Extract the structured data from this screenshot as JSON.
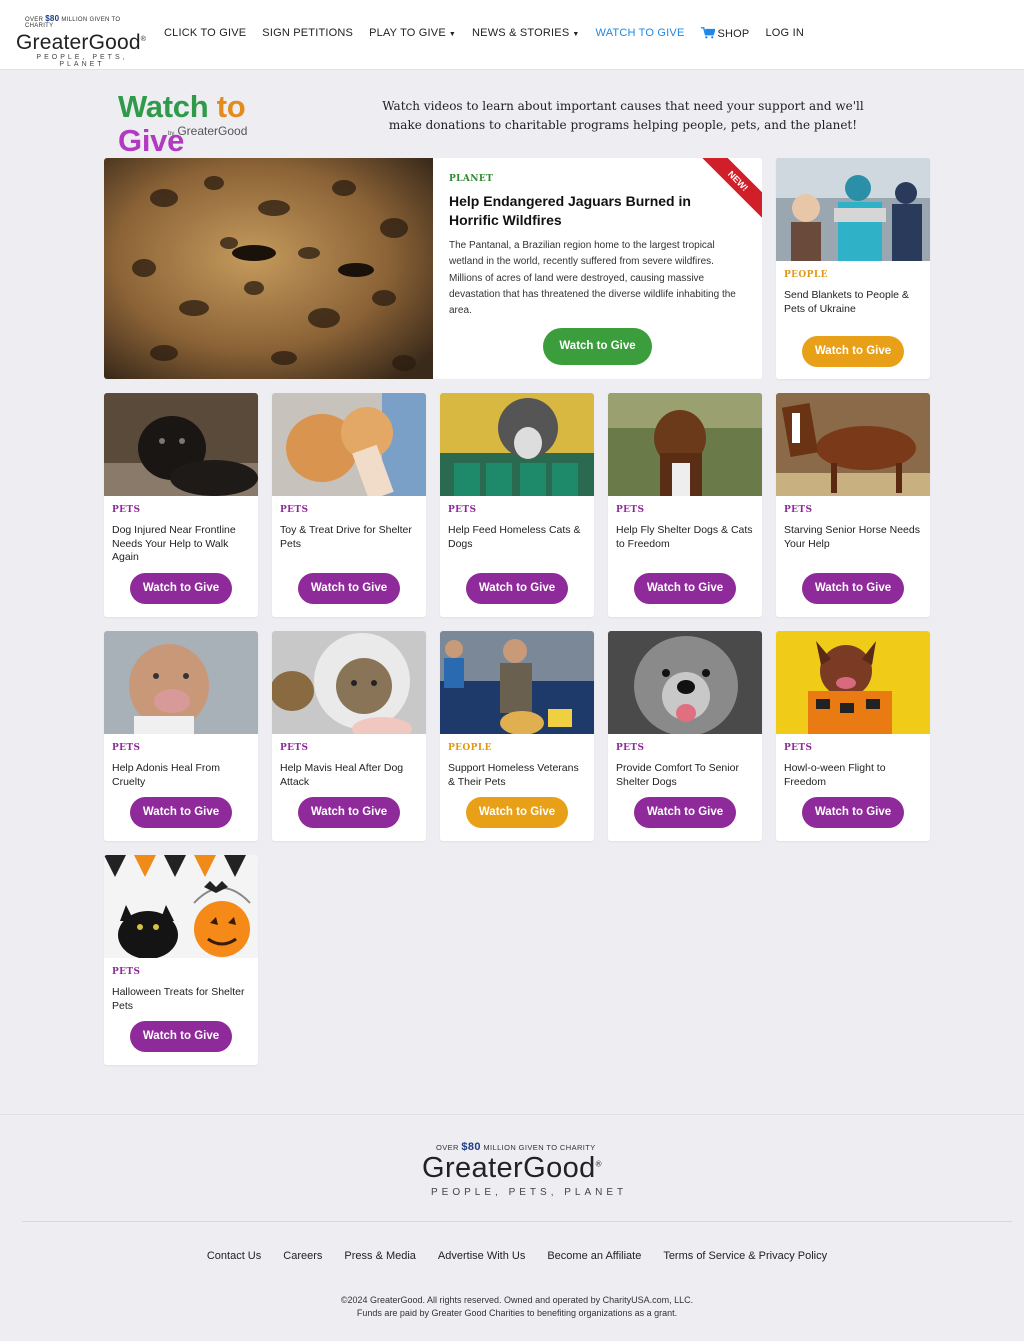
{
  "header": {
    "logo_over": "OVER",
    "logo_amount": "$80",
    "logo_over_suffix": "MILLION GIVEN TO CHARITY",
    "logo_name": "GreaterGood",
    "logo_registered": "®",
    "logo_tagline": "PEOPLE, PETS, PLANET",
    "nav": [
      {
        "label": "CLICK TO GIVE"
      },
      {
        "label": "SIGN PETITIONS"
      },
      {
        "label": "PLAY TO GIVE",
        "dropdown": true
      },
      {
        "label": "NEWS & STORIES",
        "dropdown": true
      },
      {
        "label": "WATCH TO GIVE",
        "active": true
      },
      {
        "label": "SHOP",
        "icon": "cart-icon"
      },
      {
        "label": "LOG IN"
      }
    ]
  },
  "hero": {
    "title_word1": "Watch",
    "title_word2": "to",
    "title_word3": "Give",
    "by": "by",
    "by_name": "GreaterGood",
    "intro": "Watch videos to learn about important causes that need your support and we'll make donations to charitable programs helping people, pets, and the planet!"
  },
  "featured": {
    "badge": "NEW!",
    "category": "PLANET",
    "title": "Help Endangered Jaguars Burned in Horrific Wildfires",
    "description": "The Pantanal, a Brazilian region home to the largest tropical wetland in the world, recently suffered from severe wildfires. Millions of acres of land were destroyed, causing massive devastation that has threatened the diverse wildlife inhabiting the area.",
    "button": "Watch to Give"
  },
  "side_card": {
    "category": "PEOPLE",
    "title": "Send Blankets to People & Pets of Ukraine",
    "button": "Watch to Give"
  },
  "cards": [
    {
      "category": "PETS",
      "title": "Dog Injured Near Frontline Needs Your Help to Walk Again",
      "button": "Watch to Give",
      "image": "injured-black-dog"
    },
    {
      "category": "PETS",
      "title": "Toy & Treat Drive for Shelter Pets",
      "button": "Watch to Give",
      "image": "kittens-treat"
    },
    {
      "category": "PETS",
      "title": "Help Feed Homeless Cats & Dogs",
      "button": "Watch to Give",
      "image": "dog-food-cans"
    },
    {
      "category": "PETS",
      "title": "Help Fly Shelter Dogs & Cats to Freedom",
      "button": "Watch to Give",
      "image": "brindle-dog"
    },
    {
      "category": "PETS",
      "title": "Starving Senior Horse Needs Your Help",
      "button": "Watch to Give",
      "image": "thin-horse"
    },
    {
      "category": "PETS",
      "title": "Help Adonis Heal From Cruelty",
      "button": "Watch to Give",
      "image": "pitbull-adonis"
    },
    {
      "category": "PETS",
      "title": "Help Mavis Heal After Dog Attack",
      "button": "Watch to Give",
      "image": "tabby-cat-cone"
    },
    {
      "category": "PEOPLE",
      "title": "Support Homeless Veterans & Their Pets",
      "button": "Watch to Give",
      "image": "veteran-dog"
    },
    {
      "category": "PETS",
      "title": "Provide Comfort To Senior Shelter Dogs",
      "button": "Watch to Give",
      "image": "senior-grey-dog"
    },
    {
      "category": "PETS",
      "title": "Howl-o-ween Flight to Freedom",
      "button": "Watch to Give",
      "image": "dog-halloween-sweater"
    },
    {
      "category": "PETS",
      "title": "Halloween Treats for Shelter Pets",
      "button": "Watch to Give",
      "image": "black-cat-pumpkin"
    }
  ],
  "footer": {
    "over": "OVER",
    "amount": "$80",
    "over_suffix": "MILLION GIVEN TO CHARITY",
    "name": "GreaterGood",
    "registered": "®",
    "tagline": "PEOPLE, PETS, PLANET",
    "links": [
      "Contact Us",
      "Careers",
      "Press & Media",
      "Advertise With Us",
      "Become an Affiliate",
      "Terms of Service & Privacy Policy"
    ],
    "copyright": "©2024 GreaterGood. All rights reserved. Owned and operated by CharityUSA.com, LLC.",
    "funds": "Funds are paid by Greater Good Charities to benefiting organizations as a grant."
  },
  "colors": {
    "pets": "#8e2a99",
    "people": "#e8a018",
    "planet": "#3b9d3b",
    "nav_active": "#1e88e5"
  }
}
